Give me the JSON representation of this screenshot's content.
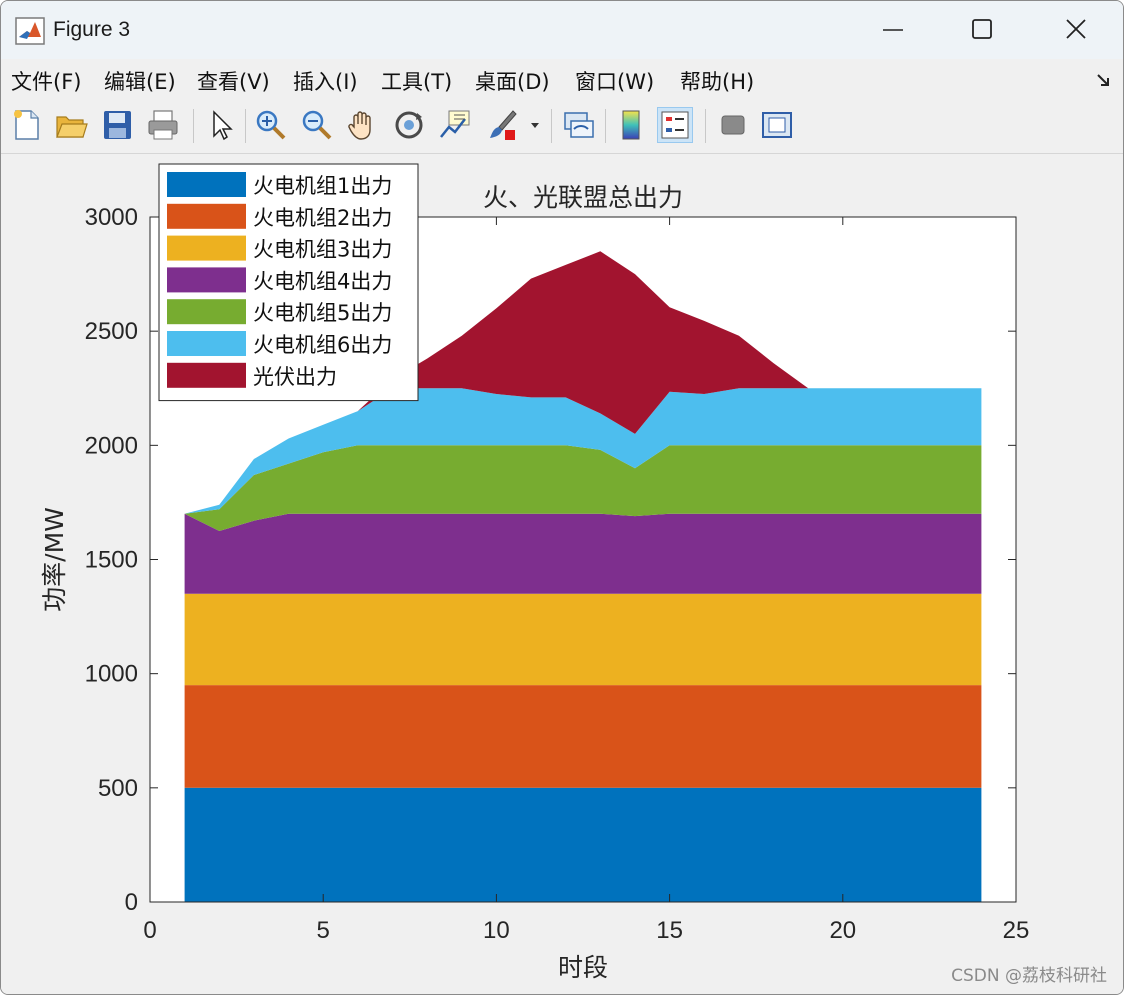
{
  "window": {
    "title": "Figure 3"
  },
  "menu": [
    "文件(F)",
    "编辑(E)",
    "查看(V)",
    "插入(I)",
    "工具(T)",
    "桌面(D)",
    "窗口(W)",
    "帮助(H)"
  ],
  "toolbar_icons": [
    "new-figure-icon",
    "open-file-icon",
    "save-icon",
    "print-icon",
    "select-arrow-icon",
    "zoom-in-icon",
    "zoom-out-icon",
    "pan-hand-icon",
    "rotate-3d-icon",
    "data-cursor-icon",
    "brush-icon",
    "brush-dropdown-icon",
    "link-plot-icon",
    "colorbar-icon",
    "legend-icon",
    "hide-plot-tools-icon",
    "show-plot-tools-icon"
  ],
  "watermark": "CSDN @荔枝科研社",
  "chart_data": {
    "type": "area",
    "stacked": true,
    "title": "火、光联盟总出力",
    "xlabel": "时段",
    "ylabel": "功率/MW",
    "xlim": [
      0,
      25
    ],
    "ylim": [
      0,
      3000
    ],
    "xticks": [
      0,
      5,
      10,
      15,
      20,
      25
    ],
    "yticks": [
      0,
      500,
      1000,
      1500,
      2000,
      2500,
      3000
    ],
    "grid": false,
    "legend_position": "top-left",
    "x": [
      1,
      2,
      3,
      4,
      5,
      6,
      7,
      8,
      9,
      10,
      11,
      12,
      13,
      14,
      15,
      16,
      17,
      18,
      19,
      20,
      21,
      22,
      23,
      24
    ],
    "series": [
      {
        "name": "火电机组1出力",
        "color": "#0072BD",
        "values": [
          500,
          500,
          500,
          500,
          500,
          500,
          500,
          500,
          500,
          500,
          500,
          500,
          500,
          500,
          500,
          500,
          500,
          500,
          500,
          500,
          500,
          500,
          500,
          500
        ]
      },
      {
        "name": "火电机组2出力",
        "color": "#D95319",
        "values": [
          450,
          450,
          450,
          450,
          450,
          450,
          450,
          450,
          450,
          450,
          450,
          450,
          450,
          450,
          450,
          450,
          450,
          450,
          450,
          450,
          450,
          450,
          450,
          450
        ]
      },
      {
        "name": "火电机组3出力",
        "color": "#EDB120",
        "values": [
          400,
          400,
          400,
          400,
          400,
          400,
          400,
          400,
          400,
          400,
          400,
          400,
          400,
          400,
          400,
          400,
          400,
          400,
          400,
          400,
          400,
          400,
          400,
          400
        ]
      },
      {
        "name": "火电机组4出力",
        "color": "#7E2F8E",
        "values": [
          350,
          275,
          320,
          350,
          350,
          350,
          350,
          350,
          350,
          350,
          350,
          350,
          350,
          340,
          350,
          350,
          350,
          350,
          350,
          350,
          350,
          350,
          350,
          350
        ]
      },
      {
        "name": "火电机组5出力",
        "color": "#77AC30",
        "values": [
          0,
          95,
          200,
          220,
          270,
          300,
          300,
          300,
          300,
          300,
          300,
          300,
          280,
          210,
          300,
          300,
          300,
          300,
          300,
          300,
          300,
          300,
          300,
          300
        ]
      },
      {
        "name": "火电机组6出力",
        "color": "#4DBEEE",
        "values": [
          0,
          20,
          70,
          110,
          120,
          150,
          250,
          250,
          250,
          225,
          210,
          210,
          160,
          150,
          235,
          225,
          250,
          250,
          250,
          250,
          250,
          250,
          250,
          250
        ]
      },
      {
        "name": "光伏出力",
        "color": "#A2142F",
        "values": [
          0,
          0,
          0,
          0,
          0,
          0,
          40,
          130,
          230,
          375,
          520,
          580,
          710,
          700,
          370,
          320,
          230,
          110,
          0,
          0,
          0,
          0,
          0,
          0
        ]
      }
    ]
  }
}
